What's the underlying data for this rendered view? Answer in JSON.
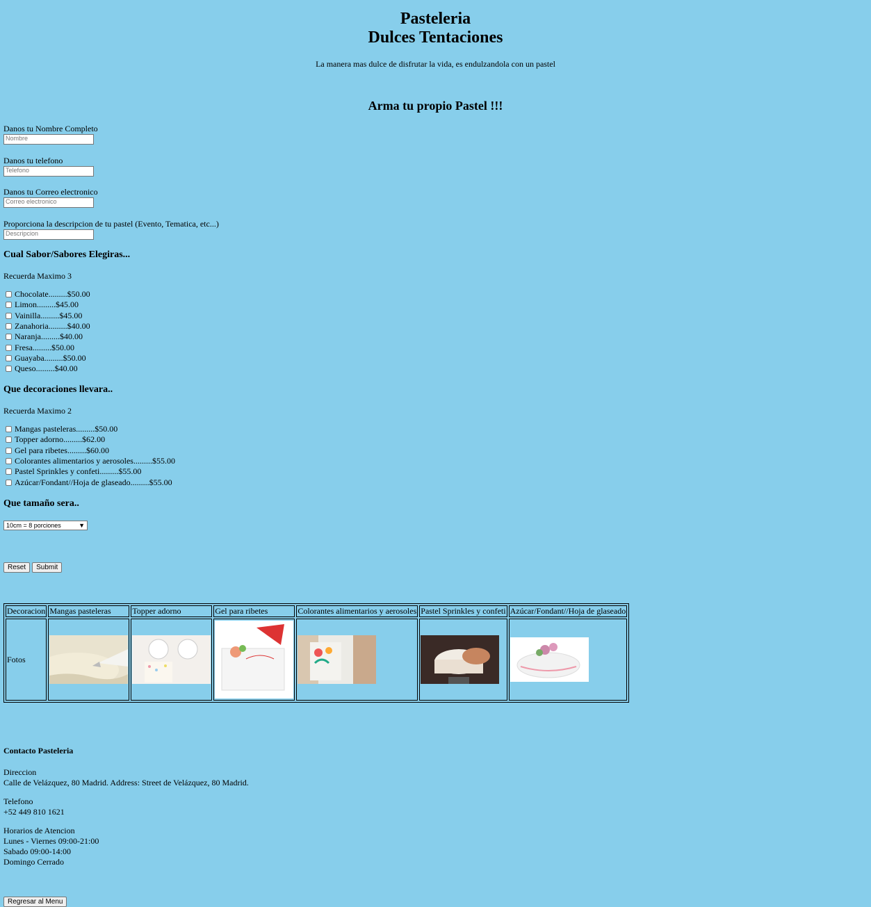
{
  "header": {
    "title_line1": "Pasteleria",
    "title_line2": "Dulces Tentaciones",
    "tagline": "La manera mas dulce de disfrutar la vida, es endulzandola con un pastel",
    "subtitle": "Arma tu propio Pastel !!!"
  },
  "form": {
    "name_label": "Danos tu Nombre Completo",
    "name_placeholder": "Nombre",
    "phone_label": "Danos tu telefono",
    "phone_placeholder": "Telefono",
    "email_label": "Danos tu Correo electronico",
    "email_placeholder": "Correo electronico",
    "desc_label": "Proporciona la descripcion de tu pastel (Evento, Tematica, etc...)",
    "desc_placeholder": "Descripcion",
    "flavors_heading": "Cual Sabor/Sabores Elegiras...",
    "flavors_note": "Recuerda Maximo 3",
    "flavors": [
      {
        "label": "Chocolate.........$50.00"
      },
      {
        "label": "Limon.........$45.00"
      },
      {
        "label": "Vainilla.........$45.00"
      },
      {
        "label": "Zanahoria.........$40.00"
      },
      {
        "label": "Naranja.........$40.00"
      },
      {
        "label": "Fresa.........$50.00"
      },
      {
        "label": "Guayaba.........$50.00"
      },
      {
        "label": "Queso.........$40.00"
      }
    ],
    "deco_heading": "Que decoraciones llevara..",
    "deco_note": "Recuerda Maximo 2",
    "decorations": [
      {
        "label": "Mangas pasteleras.........$50.00"
      },
      {
        "label": "Topper adorno.........$62.00"
      },
      {
        "label": "Gel para ribetes.........$60.00"
      },
      {
        "label": "Colorantes alimentarios y aerosoles.........$55.00"
      },
      {
        "label": "Pastel Sprinkles y confeti.........$55.00"
      },
      {
        "label": "Azúcar/Fondant//Hoja de glaseado.........$55.00"
      }
    ],
    "size_heading": "Que tamaño sera..",
    "size_selected": "10cm = 8 porciones",
    "reset_label": "Reset",
    "submit_label": "Submit"
  },
  "table": {
    "header": [
      "Decoracion",
      "Mangas pasteleras",
      "Topper adorno",
      "Gel para ribetes",
      "Colorantes alimentarios y aerosoles",
      "Pastel Sprinkles y confeti",
      "Azúcar/Fondant//Hoja de glaseado"
    ],
    "row_label": "Fotos"
  },
  "contact": {
    "heading": "Contacto Pasteleria",
    "address_label": "Direccion",
    "address": "Calle de Velázquez, 80 Madrid. Address: Street de Velázquez, 80 Madrid.",
    "phone_label": "Telefono",
    "phone": "+52 449 810 1621",
    "hours_label": "Horarios de Atencion",
    "hours_weekdays": "Lunes - Viernes 09:00-21:00",
    "hours_saturday": "Sabado 09:00-14:00",
    "hours_sunday": "Domingo Cerrado"
  },
  "back_button_label": "Regresar al Menu"
}
